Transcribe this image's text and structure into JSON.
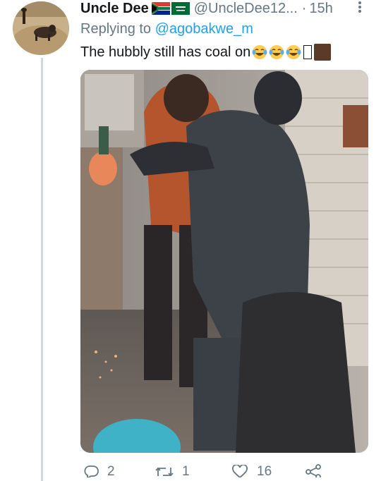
{
  "tweet": {
    "display_name": "Uncle Dee",
    "flag_icons": [
      "south-africa-flag-icon",
      "saudi-arabia-flag-icon"
    ],
    "handle": "@UncleDee12...",
    "separator": "·",
    "time": "15h",
    "reply_prefix": "Replying to",
    "reply_to": "@agobakwe_m",
    "text": "The hubbly still has coal on",
    "emojis": [
      "face-with-tears-of-joy-icon",
      "face-with-tears-of-joy-icon",
      "face-with-tears-of-joy-icon",
      "missing-glyph-icon",
      "brown-skin-tone-icon"
    ]
  },
  "actions": {
    "reply_count": "2",
    "retweet_count": "1",
    "like_count": "16"
  },
  "colors": {
    "text": "#14171a",
    "secondary": "#657786",
    "link": "#1da1f2",
    "thread_line": "#cfd9de"
  }
}
